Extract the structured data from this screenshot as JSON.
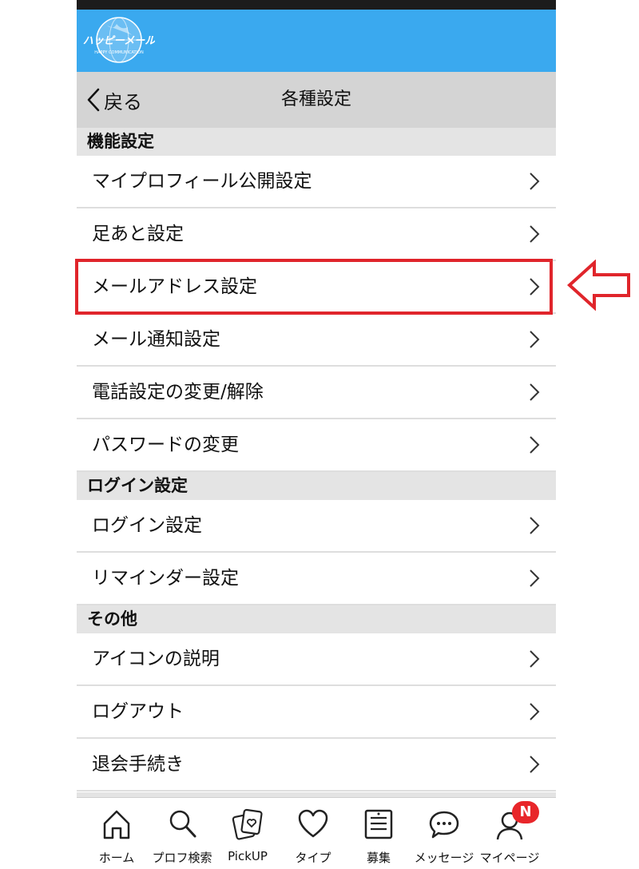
{
  "brand": {
    "logo_text": "ハッピーメール",
    "logo_subtext": "HAPPY COMMUNICATION",
    "color": "#3aa9ef"
  },
  "nav": {
    "back_label": "戻る",
    "title": "各種設定"
  },
  "sections": [
    {
      "title": "機能設定",
      "items": [
        "マイプロフィール公開設定",
        "足あと設定",
        "メールアドレス設定",
        "メール通知設定",
        "電話設定の変更/解除",
        "パスワードの変更"
      ]
    },
    {
      "title": "ログイン設定",
      "items": [
        "ログイン設定",
        "リマインダー設定"
      ]
    },
    {
      "title": "その他",
      "items": [
        "アイコンの説明",
        "ログアウト",
        "退会手続き"
      ]
    }
  ],
  "annotation": {
    "highlighted_item": "メールアドレス設定",
    "color": "#e0252b"
  },
  "tabbar": {
    "tabs": [
      {
        "label": "ホーム",
        "icon": "home-icon"
      },
      {
        "label": "プロフ検索",
        "icon": "search-icon"
      },
      {
        "label": "PickUP",
        "icon": "pickup-cards-icon"
      },
      {
        "label": "タイプ",
        "icon": "heart-icon"
      },
      {
        "label": "募集",
        "icon": "bulletin-board-icon"
      },
      {
        "label": "メッセージ",
        "icon": "chat-bubble-icon"
      },
      {
        "label": "マイページ",
        "icon": "user-icon"
      }
    ],
    "mypage_badge": "N"
  }
}
